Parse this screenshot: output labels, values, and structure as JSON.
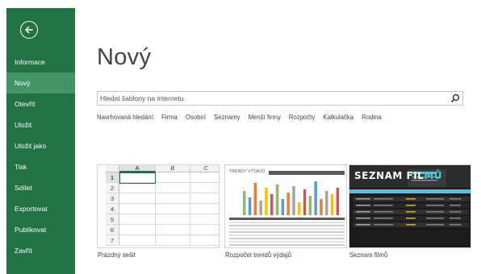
{
  "sidebar": {
    "back_icon": "back-arrow-icon",
    "accent": "#217346",
    "active_bg": "#439467",
    "items": [
      {
        "label": "Informace",
        "active": false
      },
      {
        "label": "Nový",
        "active": true
      },
      {
        "label": "Otevřít",
        "active": false
      },
      {
        "label": "Uložit",
        "active": false
      },
      {
        "label": "Uložit jako",
        "active": false
      },
      {
        "label": "Tisk",
        "active": false
      },
      {
        "label": "Sdílet",
        "active": false
      },
      {
        "label": "Exportovat",
        "active": false
      },
      {
        "label": "Publikovat",
        "active": false
      },
      {
        "label": "Zavřít",
        "active": false
      }
    ]
  },
  "main": {
    "title": "Nový",
    "search": {
      "placeholder": "Hledat šablony na internetu",
      "value": "",
      "icon": "search-icon"
    },
    "suggested": {
      "label": "Navrhovaná hledání:",
      "links": [
        "Firma",
        "Osobní",
        "Seznamy",
        "Menší firmy",
        "Rozpočty",
        "Kalkulačka",
        "Rodina"
      ]
    },
    "templates": [
      {
        "name": "Prázdný sešit",
        "columns": [
          "A",
          "B",
          "C"
        ],
        "rows": [
          "1",
          "2",
          "3",
          "4",
          "5",
          "6",
          "7"
        ],
        "selected_cell": "A1"
      },
      {
        "name": "Rozpočet trendů výdajů",
        "thumb_title": "TRENDY VÝDAJŮ"
      },
      {
        "name": "Seznam filmů",
        "thumb_title_a": "SEZNAM FIL",
        "thumb_title_b": "MŮ"
      }
    ]
  }
}
